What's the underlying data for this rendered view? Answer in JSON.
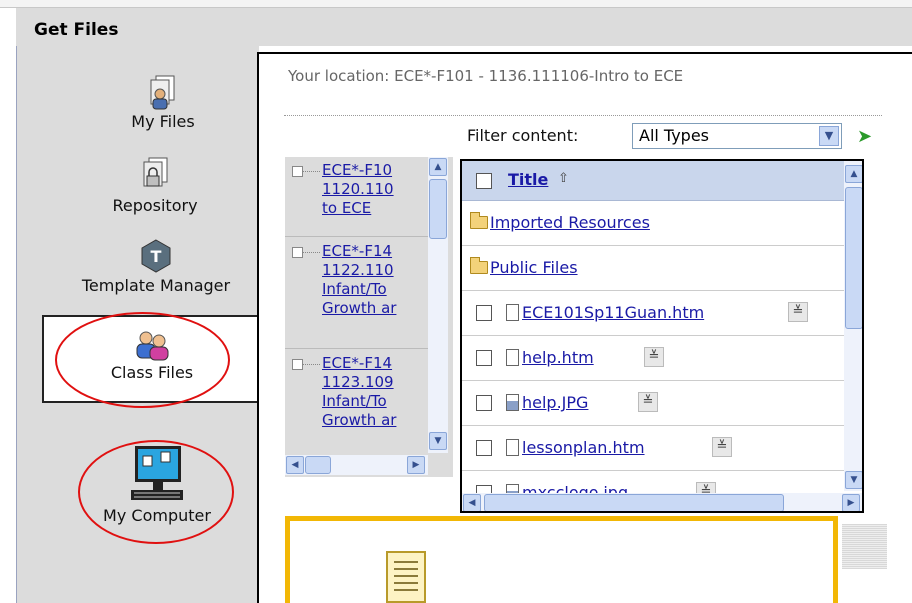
{
  "header": {
    "title": "Get Files"
  },
  "sidebar": {
    "items": [
      {
        "label": "My Files"
      },
      {
        "label": "Repository"
      },
      {
        "label": "Template Manager"
      },
      {
        "label": "Class Files"
      },
      {
        "label": "My Computer"
      }
    ]
  },
  "location": {
    "text": "Your location: ECE*-F101 - 1136.111106-Intro to ECE"
  },
  "filter": {
    "label": "Filter content:",
    "selected": "All Types"
  },
  "tree": {
    "nodes": [
      {
        "lines": [
          "ECE*-F10",
          "1120.110",
          "to ECE"
        ]
      },
      {
        "lines": [
          "ECE*-F14",
          "1122.110",
          "Infant/To",
          "Growth ar"
        ]
      },
      {
        "lines": [
          "ECE*-F14",
          "1123.109",
          "Infant/To",
          "Growth ar"
        ]
      }
    ]
  },
  "files": {
    "header": "Title",
    "rows": [
      {
        "name": "Imported Resources",
        "kind": "folder"
      },
      {
        "name": "Public Files",
        "kind": "folder"
      },
      {
        "name": "ECE101Sp11Guan.htm",
        "kind": "file"
      },
      {
        "name": "help.htm",
        "kind": "file"
      },
      {
        "name": "help.JPG",
        "kind": "image"
      },
      {
        "name": "lessonplan.htm",
        "kind": "file"
      },
      {
        "name": "mxcclogo.jpg",
        "kind": "image"
      }
    ]
  },
  "colors": {
    "annotation": "#e01010",
    "callout_border": "#f2b705",
    "link": "#1a1aa6"
  }
}
